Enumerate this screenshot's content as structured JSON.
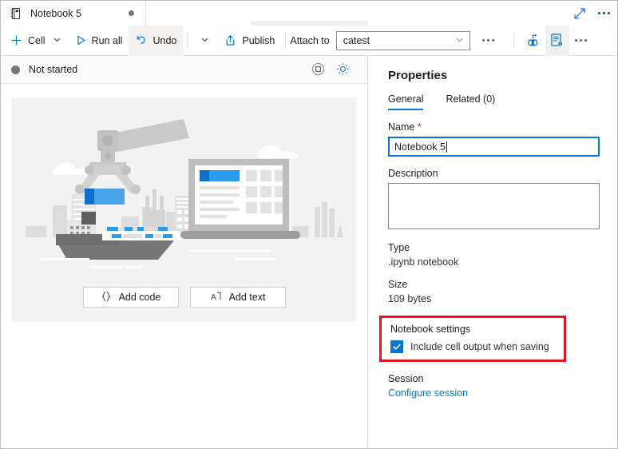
{
  "tab": {
    "icon": "notebook-icon",
    "label": "Notebook 5",
    "dirty_indicator": "unsaved-dot",
    "expand_icon": "expand-diagonal-icon",
    "more_icon": "more-horizontal-icon"
  },
  "toolbar": {
    "cell_label": "Cell",
    "run_all_label": "Run all",
    "undo_label": "Undo",
    "publish_label": "Publish",
    "attach_label": "Attach to",
    "attach_value": "catest",
    "more_label": "more-options",
    "variable_explorer_icon": "variable-explorer-icon",
    "properties_icon": "properties-gear-document-icon",
    "right_more_icon": "more-horizontal-icon"
  },
  "status": {
    "text": "Not started",
    "dot_color": "#767676",
    "stop_icon": "stop-session-icon",
    "settings_icon": "gear-icon"
  },
  "canvas": {
    "add_code_label": "Add code",
    "add_code_glyph": "{ }",
    "add_text_label": "Add text",
    "add_text_glyph": "A"
  },
  "properties": {
    "title": "Properties",
    "tabs": [
      {
        "label": "General",
        "active": true
      },
      {
        "label": "Related (0)",
        "active": false
      }
    ],
    "name_label": "Name",
    "name_required_mark": "*",
    "name_value": "Notebook 5",
    "description_label": "Description",
    "description_value": "",
    "type_label": "Type",
    "type_value": ".ipynb notebook",
    "size_label": "Size",
    "size_value": "109 bytes",
    "notebook_settings_label": "Notebook settings",
    "include_output_label": "Include cell output when saving",
    "include_output_checked": true,
    "session_label": "Session",
    "configure_session_link": "Configure session"
  },
  "colors": {
    "accent": "#0078d4",
    "highlight_box": "#e81123",
    "panel_bg": "#f2f2f2",
    "text": "#201f1e"
  }
}
